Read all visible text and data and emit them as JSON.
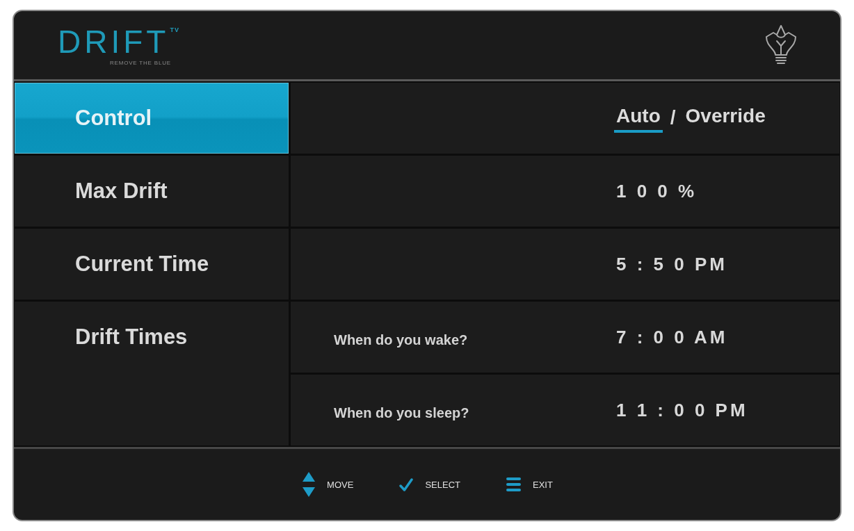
{
  "header": {
    "logo": {
      "wordmark": "DRIFT",
      "superscript": "TV",
      "tagline": "REMOVE THE BLUE"
    }
  },
  "settings": [
    {
      "kind": "toggle",
      "label": "Control",
      "selected": true,
      "separator": "/",
      "options": [
        {
          "label": "Auto",
          "selected": true
        },
        {
          "label": "Override",
          "selected": false
        }
      ]
    },
    {
      "kind": "value",
      "label": "Max Drift",
      "selected": false,
      "value": "1 0 0 %"
    },
    {
      "kind": "value",
      "label": "Current Time",
      "selected": false,
      "value": "5 : 5 0 PM"
    },
    {
      "kind": "group",
      "label": "Drift Times",
      "selected": false,
      "entries": [
        {
          "label": "When do you wake?",
          "value": "7 : 0 0 AM"
        },
        {
          "label": "When do you sleep?",
          "value": "1 1 : 0 0 PM"
        }
      ]
    }
  ],
  "footer_hints": [
    {
      "kind": "move",
      "label": "MOVE"
    },
    {
      "kind": "select",
      "label": "SELECT"
    },
    {
      "kind": "exit",
      "label": "EXIT"
    }
  ]
}
